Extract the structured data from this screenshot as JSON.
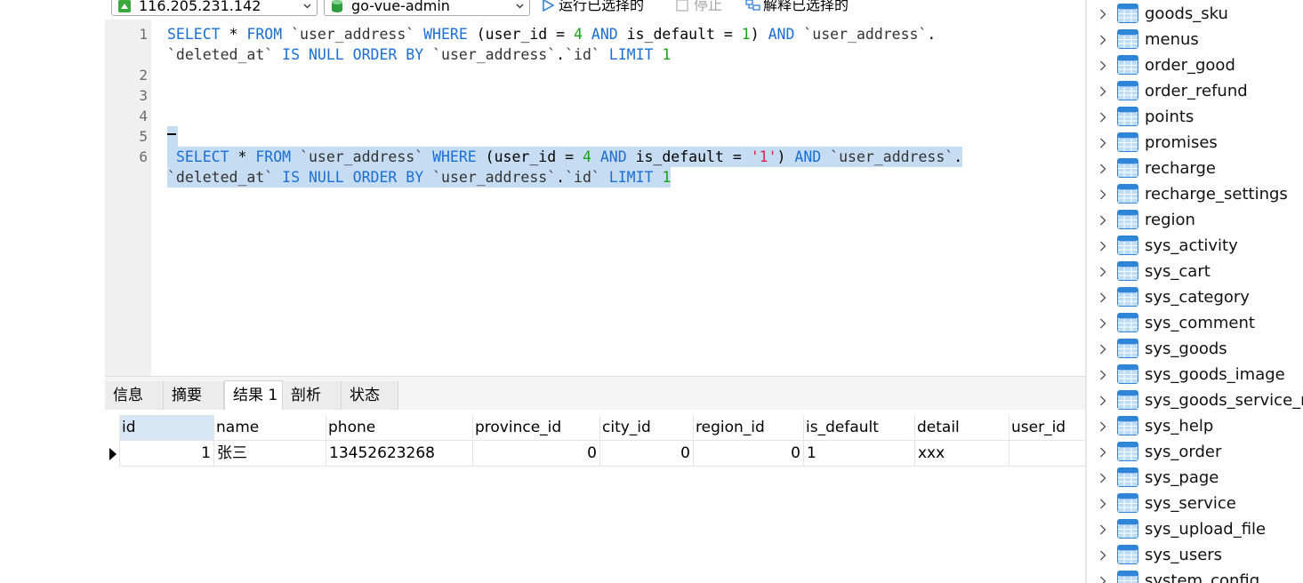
{
  "toolbar": {
    "connection": "116.205.231.142",
    "database": "go-vue-admin",
    "run_selected": "运行已选择的",
    "stop": "停止",
    "explain_selected": "解释已选择的"
  },
  "editor": {
    "line_numbers": [
      "1",
      "2",
      "3",
      "4",
      "5",
      "6"
    ],
    "line1a": "SELECT * FROM `user_address` WHERE (user_id = 4 AND is_default = 1) AND `user_address`.",
    "line1b": "`deleted_at` IS NULL ORDER BY `user_address`.`id` LIMIT 1",
    "line6a": " SELECT * FROM `user_address` WHERE (user_id = 4 AND is_default = '1') AND `user_address`.",
    "line6b": "`deleted_at` IS NULL ORDER BY `user_address`.`id` LIMIT 1"
  },
  "result_tabs": [
    "信息",
    "摘要",
    "结果 1",
    "剖析",
    "状态"
  ],
  "active_tab": "结果 1",
  "grid": {
    "columns": [
      "id",
      "name",
      "phone",
      "province_id",
      "city_id",
      "region_id",
      "is_default",
      "detail",
      "user_id"
    ],
    "rows": [
      [
        "1",
        "张三",
        "13452623268",
        "0",
        "0",
        "0",
        "1",
        "xxx",
        ""
      ]
    ]
  },
  "tree": {
    "tables": [
      "goods_sku",
      "menus",
      "order_good",
      "order_refund",
      "points",
      "promises",
      "recharge",
      "recharge_settings",
      "region",
      "sys_activity",
      "sys_cart",
      "sys_category",
      "sys_comment",
      "sys_goods",
      "sys_goods_image",
      "sys_goods_service_re",
      "sys_help",
      "sys_order",
      "sys_page",
      "sys_service",
      "sys_upload_file",
      "sys_users",
      "system_config"
    ]
  },
  "colors": {
    "keyword": "#1a6fd6",
    "number": "#18a418",
    "string": "#e0244d",
    "selection": "#c6dcf2"
  }
}
